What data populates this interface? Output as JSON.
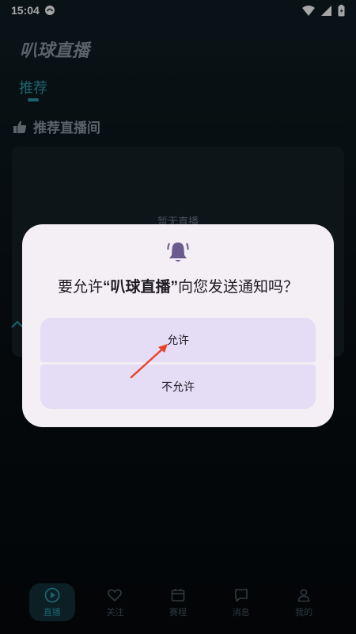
{
  "status_bar": {
    "time": "15:04",
    "icons": [
      "notification-badge-icon",
      "wifi-icon",
      "signal-icon",
      "battery-icon"
    ]
  },
  "app": {
    "title": "叭球直播",
    "tabs": [
      {
        "label": "推荐",
        "active": true
      }
    ],
    "section_title": "推荐直播间",
    "empty_text": "暂无直播"
  },
  "bottom_nav": {
    "items": [
      {
        "label": "直播",
        "icon": "play-circle-icon",
        "active": true
      },
      {
        "label": "关注",
        "icon": "heart-icon",
        "active": false
      },
      {
        "label": "赛程",
        "icon": "calendar-icon",
        "active": false
      },
      {
        "label": "消息",
        "icon": "chat-bubble-icon",
        "active": false
      },
      {
        "label": "我的",
        "icon": "person-icon",
        "active": false
      }
    ]
  },
  "dialog": {
    "prefix": "要允许",
    "app_name_quoted": "“叭球直播”",
    "suffix": "向您发送通知吗？",
    "allow_label": "允许",
    "deny_label": "不允许"
  },
  "colors": {
    "accent": "#2a9aa8",
    "dialog_bg": "#f3eff5",
    "button_bg": "#e5dcf5",
    "bell": "#6b5a8e",
    "arrow": "#e8442c"
  }
}
